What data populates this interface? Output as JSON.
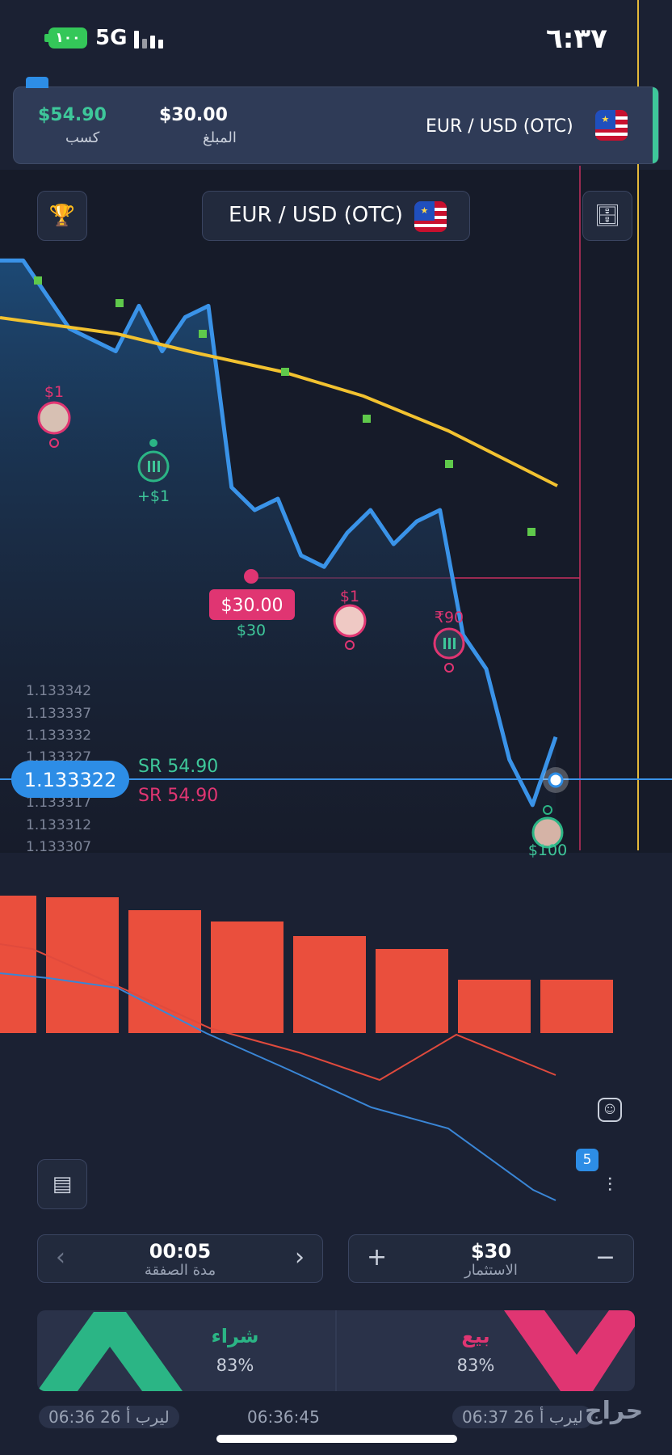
{
  "status_bar": {
    "time": "٦:٣٧",
    "battery": "١٠٠",
    "network": "5G"
  },
  "trade_card": {
    "profit_value": "$54.90",
    "profit_label": "كسب",
    "amount_value": "$30.00",
    "amount_label": "المبلغ",
    "pair": "EUR / USD (OTC)"
  },
  "asset_selector": {
    "pair": "EUR / USD (OTC)"
  },
  "chart": {
    "price_ticks": [
      "1.133342",
      "1.133337",
      "1.133332",
      "1.133327",
      "1.133317",
      "1.133312",
      "1.133307"
    ],
    "current_price": "1.133322",
    "sr_up": "SR 54.90",
    "sr_down": "SR 54.90",
    "trade_marker_label": "$30.00",
    "trade_marker_sub": "$30",
    "bubbles": [
      {
        "label": "$1"
      },
      {
        "label": "+$1"
      },
      {
        "label": "$1"
      },
      {
        "label": "₹90"
      },
      {
        "label": "$100"
      }
    ],
    "indicator_badge": "5"
  },
  "chart_data": {
    "type": "line",
    "series": [
      {
        "y": [
          1.133352,
          1.133352,
          1.133349,
          1.133346,
          1.133345,
          1.133344,
          1.133348,
          1.133344,
          1.133347,
          1.133348,
          1.133332,
          1.13333,
          1.133331,
          1.133326,
          1.133325,
          1.133328,
          1.13333,
          1.133327,
          1.133329,
          1.13333,
          1.133319,
          1.133316,
          1.133308,
          1.133304,
          1.13331
        ]
      }
    ],
    "ylim": [
      1.1333,
      1.13336
    ],
    "colors": {
      "line": "#3a93e8",
      "fill_top": "#1d4b78",
      "ma": "#f2c230",
      "dots": "#5fc94b",
      "bar": "#ea4f3d",
      "signal_red": "#e04a3d",
      "signal_blue": "#3a86d6"
    },
    "histogram": [
      0.85,
      0.84,
      0.76,
      0.69,
      0.6,
      0.52,
      0.33,
      0.33
    ]
  },
  "controls": {
    "duration_value": "00:05",
    "duration_label": "مدة الصفقة",
    "investment_value": "$30",
    "investment_label": "الاستثمار",
    "buy_label": "شراء",
    "buy_percent": "83%",
    "sell_label": "بيع",
    "sell_percent": "83%"
  },
  "timeline": {
    "left": "06:36 26 ليرب أ",
    "center": "06:36:45",
    "right": "06:37 26 ليرب أ"
  },
  "watermark": "حراج",
  "colors": {
    "buy": "#2bb585",
    "sell": "#e03572",
    "accent": "#3ec79a"
  }
}
